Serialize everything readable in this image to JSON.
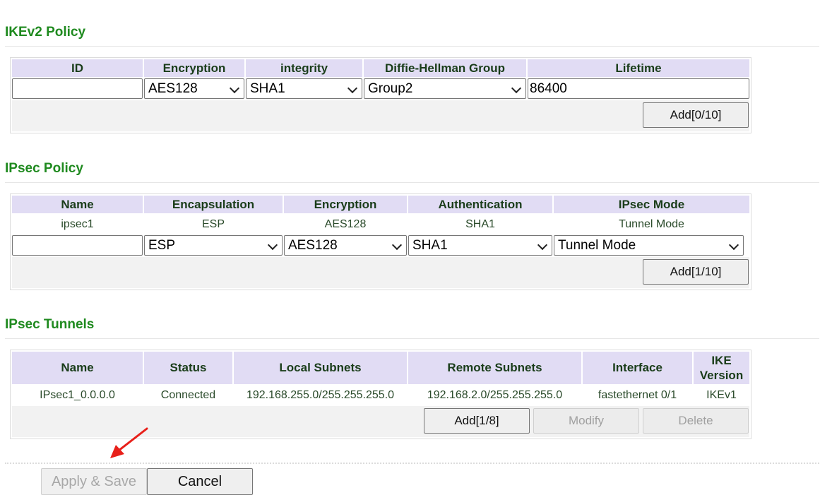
{
  "ike": {
    "title": "IKEv2 Policy",
    "headers": [
      "ID",
      "Encryption",
      "integrity",
      "Diffie-Hellman Group",
      "Lifetime"
    ],
    "form": {
      "id_value": "",
      "encryption": "AES128",
      "integrity": "SHA1",
      "dh_group": "Group2",
      "lifetime": "86400"
    },
    "add_label": "Add[0/10]"
  },
  "ipsec_policy": {
    "title": "IPsec Policy",
    "headers": [
      "Name",
      "Encapsulation",
      "Encryption",
      "Authentication",
      "IPsec Mode"
    ],
    "rows": [
      {
        "name": "ipsec1",
        "encapsulation": "ESP",
        "encryption": "AES128",
        "authentication": "SHA1",
        "mode": "Tunnel Mode"
      }
    ],
    "form": {
      "name_value": "",
      "encapsulation": "ESP",
      "encryption": "AES128",
      "authentication": "SHA1",
      "mode": "Tunnel Mode"
    },
    "add_label": "Add[1/10]"
  },
  "tunnels": {
    "title": "IPsec Tunnels",
    "headers": [
      "Name",
      "Status",
      "Local Subnets",
      "Remote Subnets",
      "Interface",
      "IKE Version"
    ],
    "rows": [
      {
        "name": "IPsec1_0.0.0.0",
        "status": "Connected",
        "local": "192.168.255.0/255.255.255.0",
        "remote": "192.168.2.0/255.255.255.0",
        "interface": "fastethernet 0/1",
        "ike_version": "IKEv1"
      }
    ],
    "add_label": "Add[1/8]",
    "modify_label": "Modify",
    "delete_label": "Delete"
  },
  "footer": {
    "apply_label": "Apply & Save",
    "cancel_label": "Cancel"
  },
  "colors": {
    "section_title": "#1f8a1f",
    "header_bg": "#e1dcf4",
    "annotation_arrow": "#e8201a"
  }
}
